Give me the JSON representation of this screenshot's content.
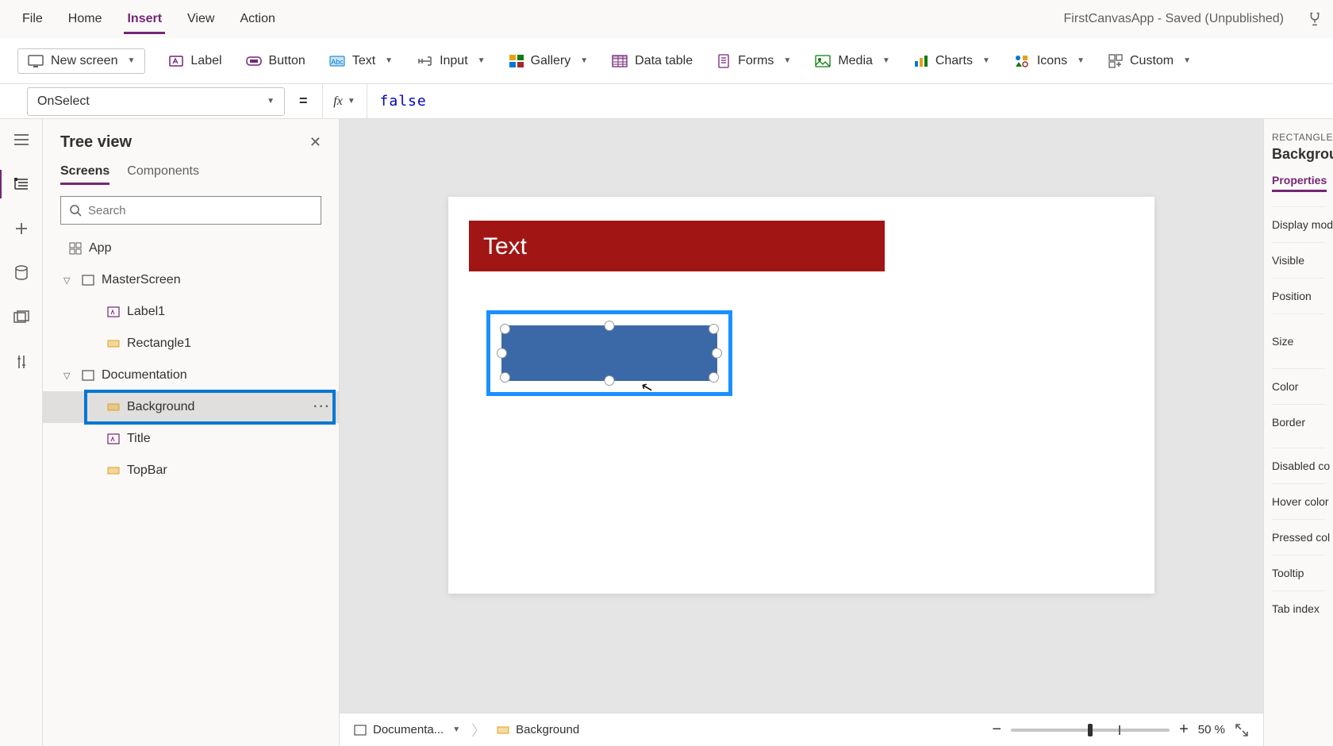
{
  "menubar": {
    "items": [
      "File",
      "Home",
      "Insert",
      "View",
      "Action"
    ],
    "active_index": 2,
    "title": "FirstCanvasApp - Saved (Unpublished)"
  },
  "ribbon": {
    "new_screen": "New screen",
    "label": "Label",
    "button": "Button",
    "text": "Text",
    "input": "Input",
    "gallery": "Gallery",
    "data_table": "Data table",
    "forms": "Forms",
    "media": "Media",
    "charts": "Charts",
    "icons": "Icons",
    "custom": "Custom"
  },
  "formula": {
    "property": "OnSelect",
    "fx_label": "fx",
    "value": "false"
  },
  "tree": {
    "title": "Tree view",
    "tabs": [
      "Screens",
      "Components"
    ],
    "active_tab": 0,
    "search_placeholder": "Search",
    "app_label": "App",
    "nodes": [
      {
        "name": "MasterScreen",
        "type": "screen",
        "children": [
          {
            "name": "Label1",
            "type": "label"
          },
          {
            "name": "Rectangle1",
            "type": "rect"
          }
        ]
      },
      {
        "name": "Documentation",
        "type": "screen",
        "children": [
          {
            "name": "Background",
            "type": "rect",
            "selected": true
          },
          {
            "name": "Title",
            "type": "label"
          },
          {
            "name": "TopBar",
            "type": "rect"
          }
        ]
      }
    ]
  },
  "canvas": {
    "topbar_text": "Text"
  },
  "status": {
    "screen": "Documenta...",
    "control": "Background",
    "zoom": "50  %"
  },
  "props": {
    "type_label": "RECTANGLE",
    "name": "Backgroun",
    "tab": "Properties",
    "rows": [
      "Display mod",
      "Visible",
      "Position",
      "Size",
      "Color",
      "Border",
      "Disabled co",
      "Hover color",
      "Pressed col",
      "Tooltip",
      "Tab index"
    ]
  }
}
